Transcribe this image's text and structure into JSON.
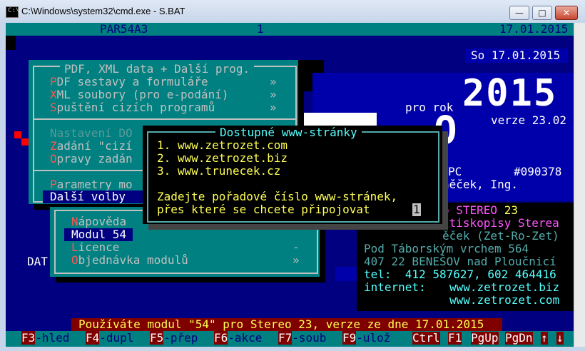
{
  "window": {
    "title": "C:\\Windows\\system32\\cmd.exe - S.BAT",
    "icon_text": "C:\\",
    "minimize": "—",
    "maximize": "□",
    "close": "✕"
  },
  "header": {
    "program": "PAR54A3",
    "number": "1",
    "date": "17.01.2015"
  },
  "date_box": "So 17.01.2015",
  "banner": {
    "pro_rok": "pro rok",
    "year": "2015",
    "version": "verze 23.02",
    "pc": "PC",
    "license_no": "#090378",
    "owner": "něček, Ing.",
    "logo_letter": "E",
    "logo_letter2": "O"
  },
  "info": {
    "line1_prefix": "o ",
    "line1_product": "STEREO",
    "line1_version": " 23",
    "line2": "-tiskopisy Sterea",
    "line3": "ěček (Zet-Ro-Zet)",
    "line4": "Pod Táborským vrchem 564",
    "line5": "407 22 BENEŠOV nad Ploučnicí",
    "tel_label": "tel:",
    "tel_value": "412 587627, 602 464416",
    "internet_label": "internet:",
    "url1": "www.zetrozet.biz",
    "url2": "www.zetrozet.com"
  },
  "dat_label": "DAT",
  "main_menu": {
    "title": "PDF, XML data + Další prog.",
    "items": [
      {
        "hot": "P",
        "rest": "DF sestavy a formuláře",
        "arrow": "»"
      },
      {
        "hot": "X",
        "rest": "ML soubory (pro e-podání)",
        "arrow": "»"
      },
      {
        "hot": "S",
        "rest": "puštění cizích programů",
        "arrow": "»"
      }
    ],
    "items2": [
      {
        "hot": "N",
        "rest": "astavení DO"
      },
      {
        "hot": "Z",
        "rest": "adání \"cizí"
      },
      {
        "hot": "O",
        "rest": "pravy zadán"
      }
    ],
    "items3": [
      {
        "hot": "P",
        "rest": "arametry mo"
      },
      {
        "hot": "D",
        "rest": "alší volby",
        "selected": true
      }
    ]
  },
  "sub_menu": {
    "items": [
      {
        "hot": "N",
        "rest": "ápověda"
      },
      {
        "hot": "M",
        "rest": "odul 54",
        "selected": true
      },
      {
        "hot": "L",
        "rest": "icence",
        "arrow": "-"
      },
      {
        "hot": "O",
        "rest": "bjednávka modulů",
        "arrow": "»"
      }
    ]
  },
  "dialog": {
    "title": "Dostupné www-stránky",
    "options": [
      "1. www.zetrozet.com",
      "2. www.zetrozet.biz",
      "3. www.trunecek.cz"
    ],
    "prompt_line1": "Zadejte pořadové číslo www-stránek,",
    "prompt_line2": "přes které se chcete připojovat",
    "input_value": "1"
  },
  "status_message": "Používáte modul \"54\" pro Stereo 23, verze ze dne 17.01.2015",
  "fkeys": [
    {
      "key": "F3",
      "label": "-hled"
    },
    {
      "key": "F4",
      "label": "-dupl"
    },
    {
      "key": "F5",
      "label": "-přep"
    },
    {
      "key": "F6",
      "label": "-akce"
    },
    {
      "key": "F7",
      "label": "-soub"
    },
    {
      "key": "F9",
      "label": "-ulož"
    },
    {
      "key": "Ctrl",
      "label": ""
    },
    {
      "key": "F1",
      "label": ""
    },
    {
      "key": "PgUp",
      "label": ""
    },
    {
      "key": "PgDn",
      "label": ""
    },
    {
      "key": "↑",
      "label": ""
    },
    {
      "key": "↓",
      "label": ""
    }
  ],
  "colors": {
    "console_bg": "#000080",
    "menu_bg": "#008080",
    "dialog_bg": "#000000",
    "highlight": "#ffff55",
    "status_bg": "#800000"
  }
}
